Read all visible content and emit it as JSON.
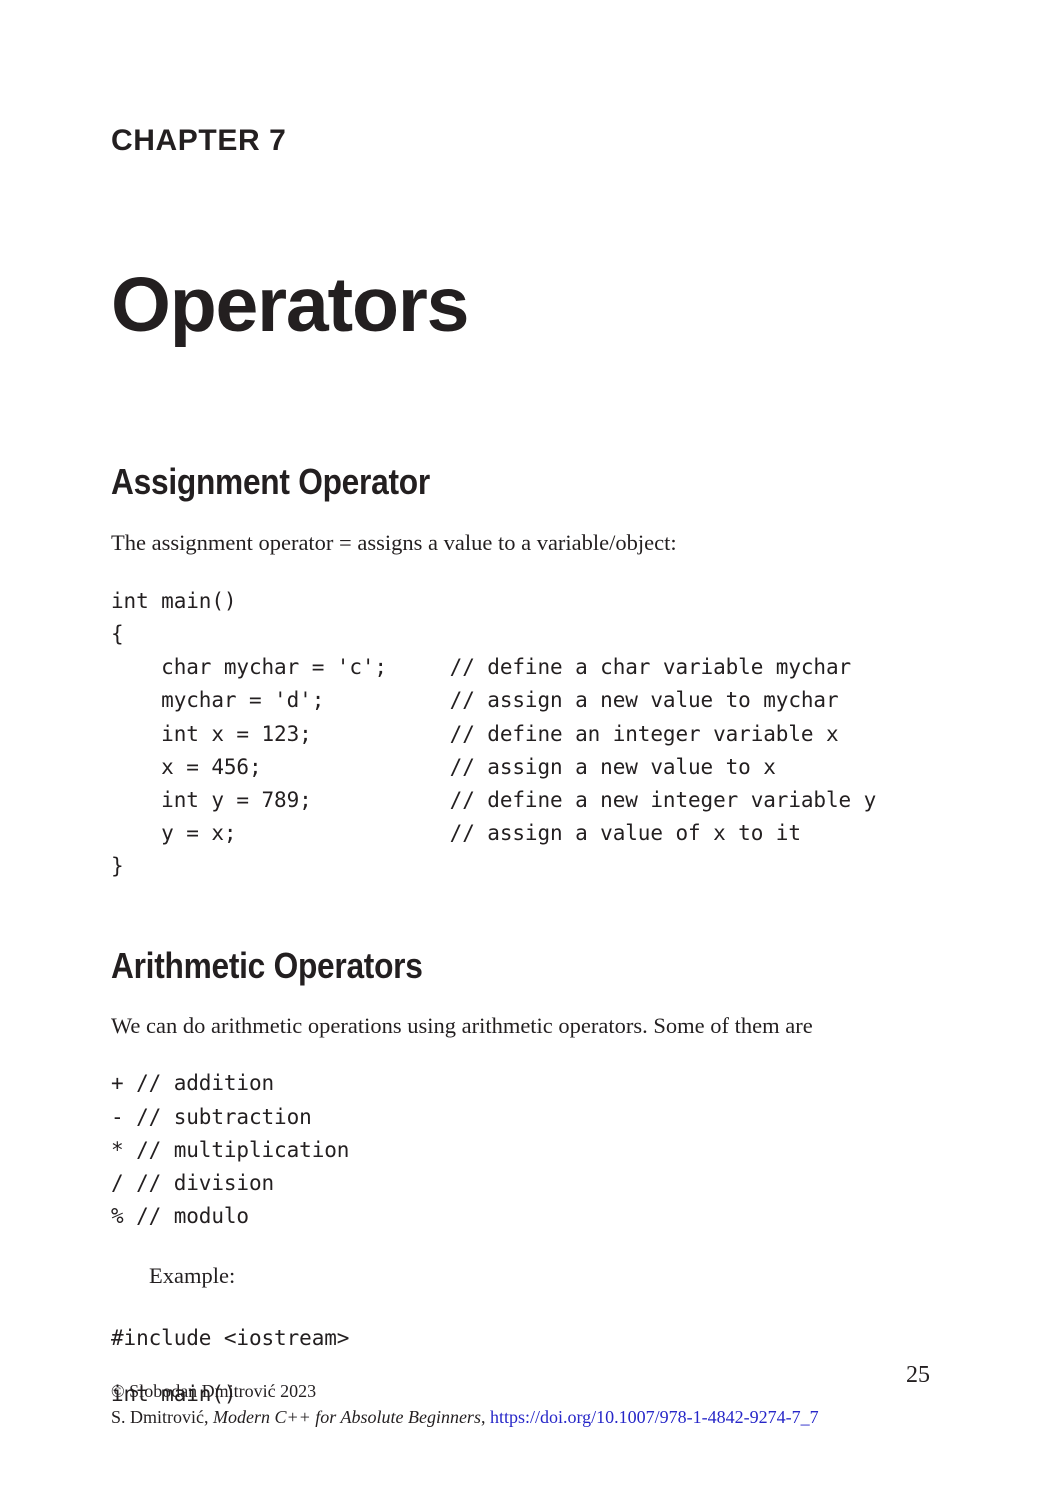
{
  "chapter": {
    "label": "CHAPTER 7",
    "title": "Operators"
  },
  "sections": {
    "assignment": {
      "heading": "Assignment Operator",
      "intro": "The assignment operator = assigns a value to a variable/object:",
      "code": "int main()\n{\n    char mychar = 'c';     // define a char variable mychar\n    mychar = 'd';          // assign a new value to mychar\n    int x = 123;           // define an integer variable x\n    x = 456;               // assign a new value to x\n    int y = 789;           // define a new integer variable y\n    y = x;                 // assign a value of x to it\n}"
    },
    "arithmetic": {
      "heading": "Arithmetic Operators",
      "intro": "We can do arithmetic operations using arithmetic operators. Some of them are",
      "operator_list": "+ // addition\n- // subtraction\n* // multiplication\n/ // division\n% // modulo",
      "example_label": "Example:",
      "include_line": "#include <iostream>",
      "main_line": "int main()"
    }
  },
  "footer": {
    "copyright": "© Slobodan Dmitrović 2023",
    "author": "S. Dmitrović, ",
    "book_title": "Modern C++ for Absolute Beginners",
    "separator": ", ",
    "doi": "https://doi.org/10.1007/978-1-4842-9274-7_7",
    "page_number": "25",
    "link_color": "#2626c8"
  }
}
